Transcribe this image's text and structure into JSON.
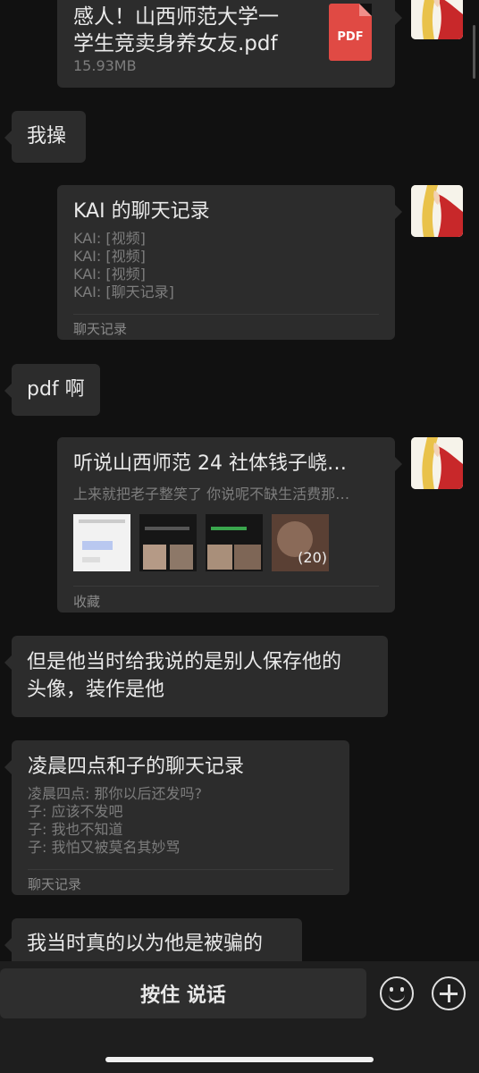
{
  "messages": {
    "file": {
      "name_line1": "感人！山西师范大学一",
      "name_line2": "学生竞卖身养女友.pdf",
      "size": "15.93MB",
      "badge": "PDF"
    },
    "msg1": "我操",
    "record1": {
      "title": "KAI 的聊天记录",
      "lines": [
        "KAI: [视频]",
        "KAI: [视频]",
        "KAI: [视频]",
        "KAI: [聊天记录]"
      ],
      "footer": "聊天记录"
    },
    "msg2": "pdf 啊",
    "favorite": {
      "title": "听说山西师范 24 社体钱子峣…",
      "desc": "上来就把老子整笑了 你说呢不缺生活费那…",
      "thumb_count": "(20)",
      "footer": "收藏"
    },
    "msg3_line1": "但是他当时给我说的是别人保存他的",
    "msg3_line2": "头像，装作是他",
    "record2": {
      "title": "凌晨四点和子的聊天记录",
      "lines": [
        "凌晨四点: 那你以后还发吗?",
        "子: 应该不发吧",
        "子: 我也不知道",
        "子: 我怕又被莫名其妙骂"
      ],
      "footer": "聊天记录"
    },
    "msg4": "我当时真的以为他是被骗的"
  },
  "input_bar": {
    "hold_to_talk": "按住 说话",
    "emoji_icon": "smiley-icon",
    "plus_icon": "plus-icon"
  },
  "colors": {
    "background": "#111111",
    "bubble": "#2c2c2c",
    "pdf_red": "#e04a44"
  }
}
